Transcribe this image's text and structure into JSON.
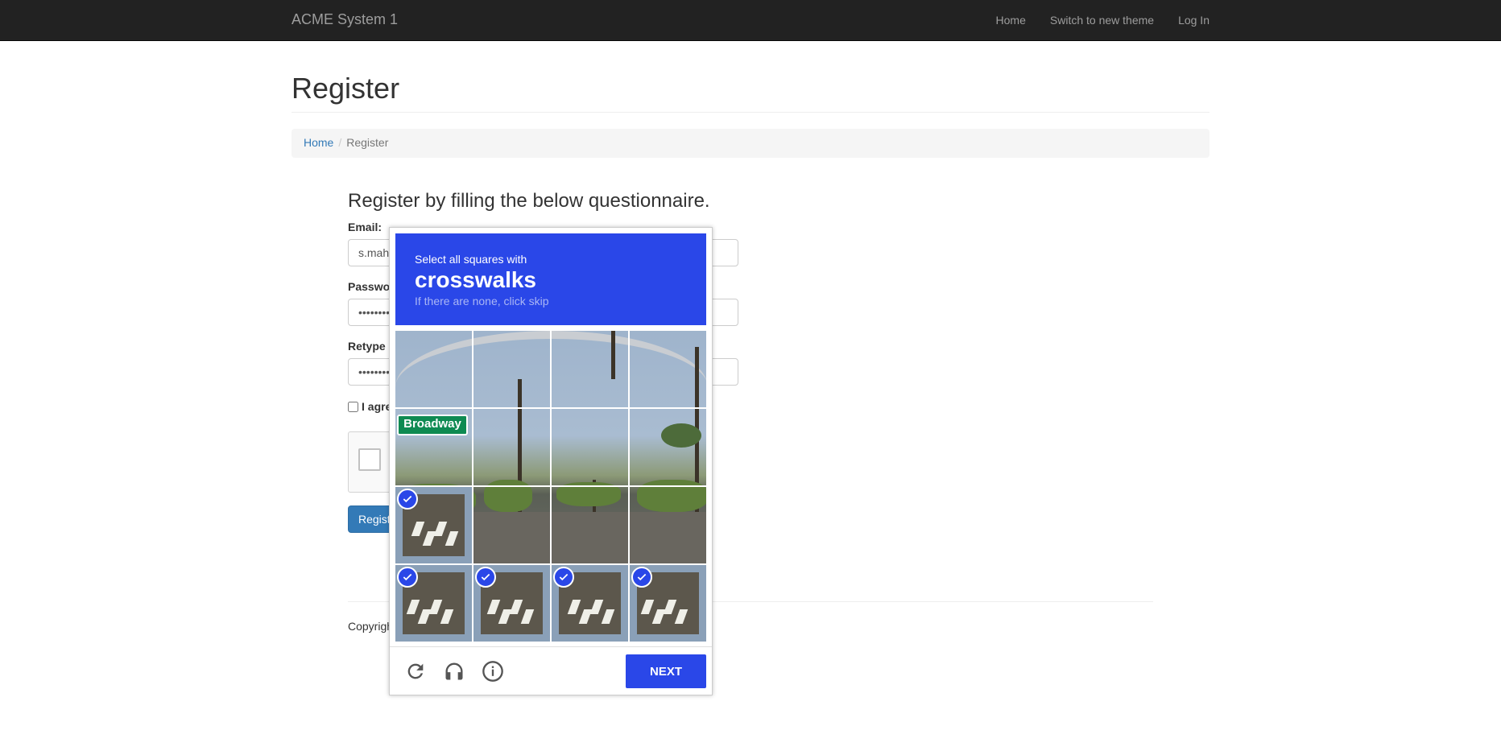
{
  "navbar": {
    "brand": "ACME System 1",
    "links": [
      "Home",
      "Switch to new theme",
      "Log In"
    ]
  },
  "page": {
    "title": "Register"
  },
  "breadcrumb": {
    "home": "Home",
    "current": "Register"
  },
  "form": {
    "lead": "Register by filling the below questionnaire.",
    "email_label": "Email:",
    "email_value": "s.mah",
    "password_label": "Passwo",
    "password_value": "••••••••",
    "retype_label": "Retype",
    "retype_value": "••••••••",
    "agree_label": "I agre",
    "register_label": "Regist"
  },
  "footer": {
    "copyright": "Copyrigh"
  },
  "captcha": {
    "instruction": "Select all squares with",
    "target": "crosswalks",
    "hint": "If there are none, click skip",
    "sign_text": "Broadway",
    "next_label": "NEXT",
    "selected_tiles": [
      8,
      12,
      13,
      14,
      15
    ],
    "icons": [
      "reload-icon",
      "audio-icon",
      "info-icon"
    ],
    "accent_color": "#2a47e8"
  }
}
